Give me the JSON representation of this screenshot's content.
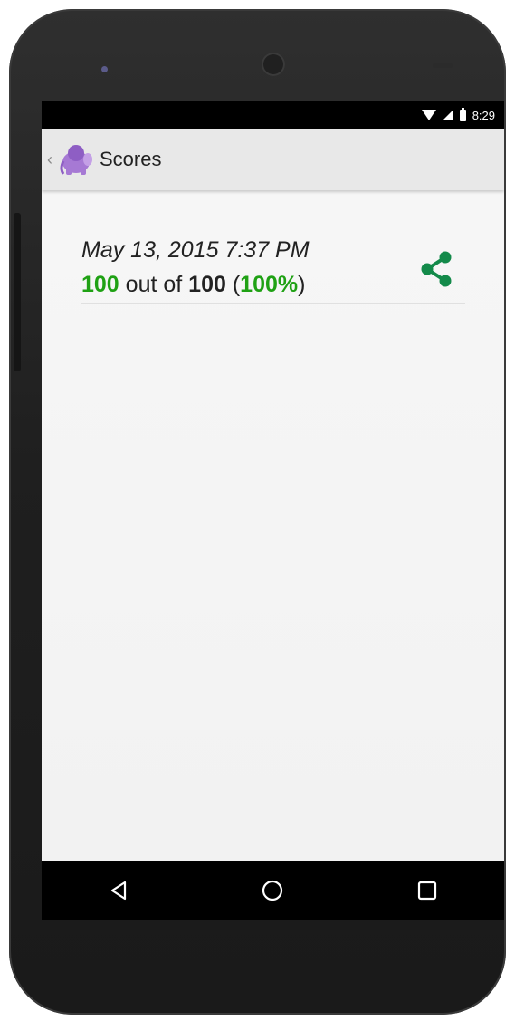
{
  "status_bar": {
    "time": "8:29",
    "icons": [
      "wifi-icon",
      "signal-icon",
      "battery-icon"
    ]
  },
  "action_bar": {
    "title": "Scores",
    "up_icon": "chevron-left-icon",
    "app_icon": "elephant-icon"
  },
  "scores": [
    {
      "date": "May 13, 2015 7:37 PM",
      "score": "100",
      "out_of_text": " out of ",
      "total": "100",
      "open_paren": " (",
      "percent": "100%",
      "close_paren": ")",
      "share_icon": "share-icon"
    }
  ],
  "nav_bar": {
    "buttons": [
      "back-icon",
      "home-icon",
      "recents-icon"
    ]
  },
  "colors": {
    "score_green": "#1fa114",
    "share_green": "#138a4a",
    "app_icon_purple": "#a679d4",
    "action_bar_bg": "#e8e8e8",
    "phone_body": "#242424"
  }
}
